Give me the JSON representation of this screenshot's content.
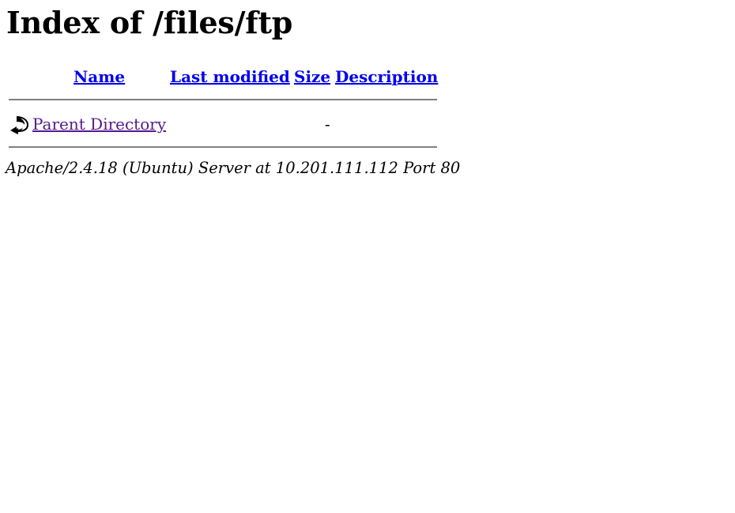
{
  "page": {
    "title": "Index of /files/ftp"
  },
  "table": {
    "headers": {
      "name": "Name",
      "last_modified": "Last modified",
      "size": "Size",
      "description": "Description"
    },
    "rows": [
      {
        "icon": "back-icon",
        "name": "Parent Directory",
        "last_modified": "",
        "size": "-",
        "description": ""
      }
    ]
  },
  "footer": {
    "text": "Apache/2.4.18 (Ubuntu) Server at 10.201.111.112 Port 80"
  },
  "colors": {
    "link": "#0000ee",
    "visited_link": "#551a8b",
    "rule": "#808080"
  }
}
